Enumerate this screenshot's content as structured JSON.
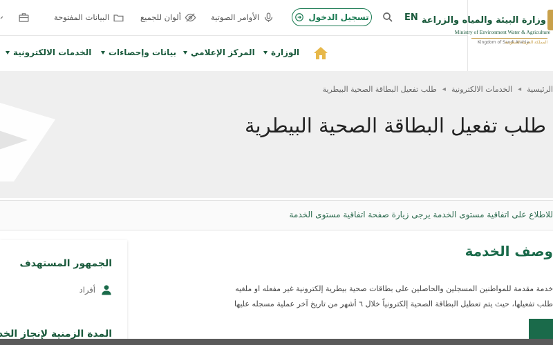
{
  "header": {
    "logo_ar": "وزارة البيئة والمياه والزراعة",
    "logo_en": "Ministry of Environment Water & Agriculture",
    "logo_ksa_en": "Kingdom of Saudi Arabia",
    "logo_ksa_ar": "المملكة العربية السعودية",
    "lang": "EN",
    "login_label": "تسجيل الدخول",
    "tools": {
      "voice_commands": "الأوامر الصوتية",
      "colors_for_all": "ألوان للجميع",
      "open_data": "البيانات المفتوحة"
    }
  },
  "nav": {
    "items": [
      {
        "label": "الوزارة"
      },
      {
        "label": "المركز الإعلامي"
      },
      {
        "label": "بيانات وإحصاءات"
      },
      {
        "label": "الخدمات الالكترونية"
      }
    ]
  },
  "banner": {
    "breadcrumb": [
      "الرئيسية",
      "الخدمات الالكترونية",
      "طلب تفعيل البطاقة الصحية البيطرية"
    ],
    "title": "طلب تفعيل البطاقة الصحية البيطرية"
  },
  "notice": "للاطلاع على اتفاقية مستوى الخدمة يرجى زيارة صفحة اتفاقية مستوى الخدمة",
  "sidebar": {
    "heading": "الجمهور المستهدف",
    "audience": "أفراد",
    "heading2": "المدة الزمنية لإنجاز الخدمة"
  },
  "service": {
    "title": "وصف الخدمة",
    "description": "خدمة مقدمة للمواطنين المسجلين والحاصلين على بطاقات صحية بيطرية إلكترونية غير مفعله او ملغيه طلب تفعيلها، حيث يتم تعطيل البطاقة الصحية إلكترونياً خلال ٦ أشهر من تاريخ آخر عملية مسجله عليها"
  },
  "colors": {
    "primary": "#1a6a4a",
    "accent": "#c8a04a"
  }
}
